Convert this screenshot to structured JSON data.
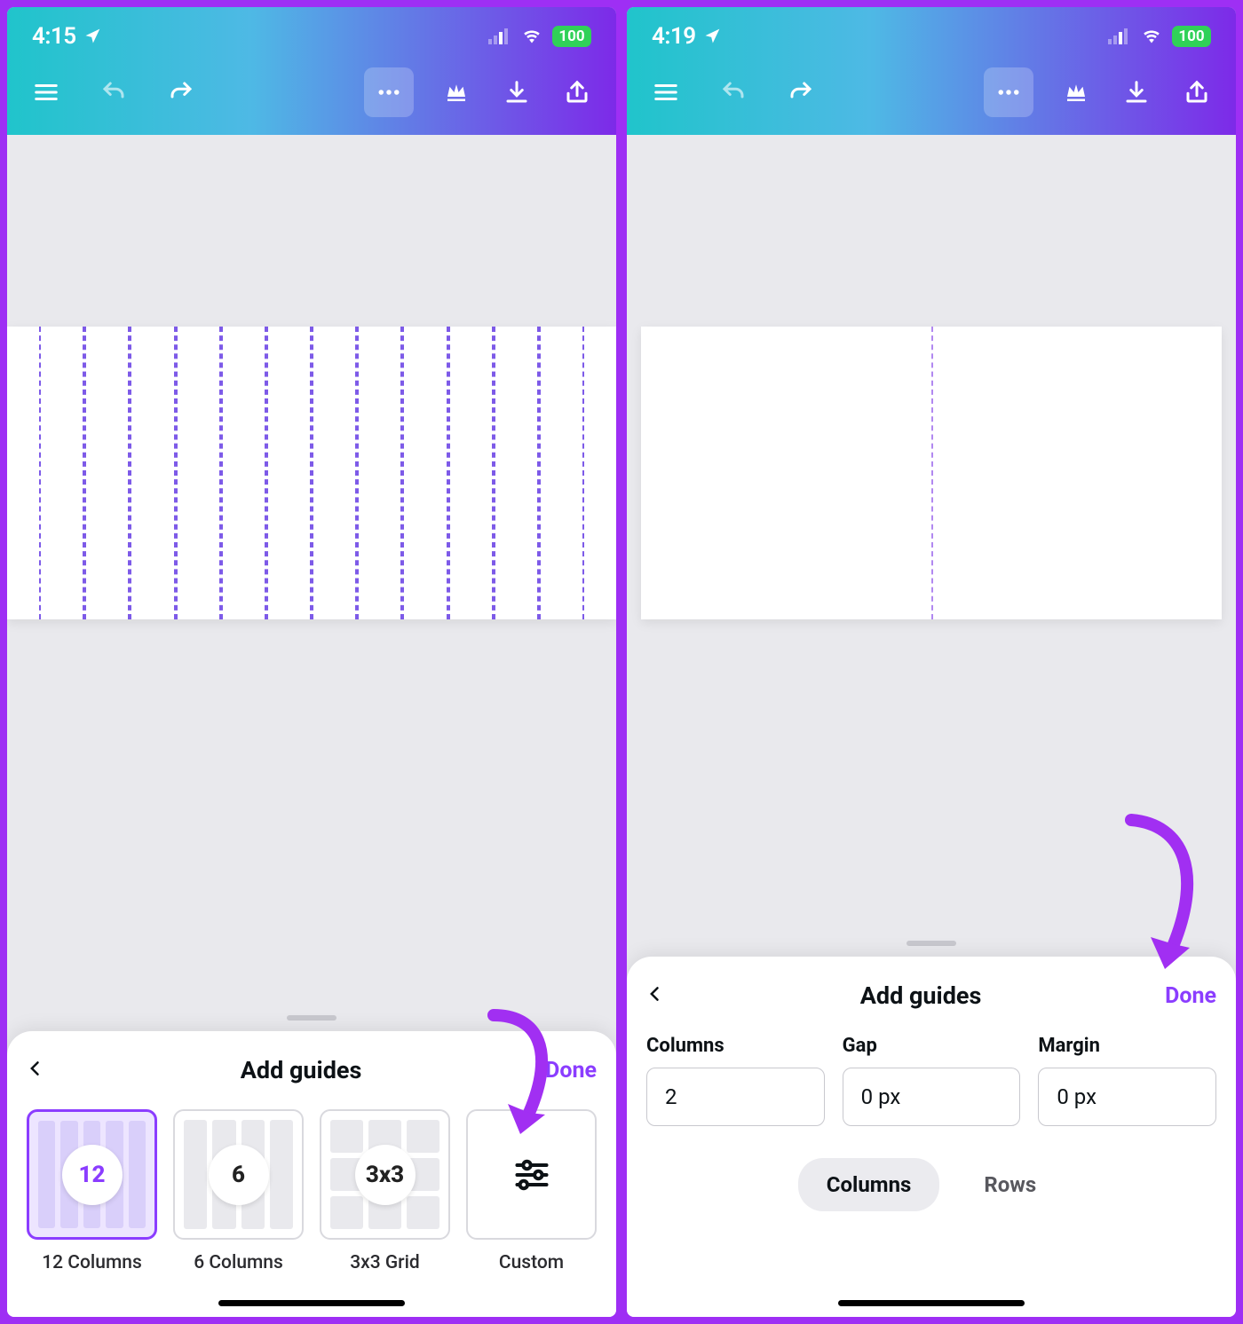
{
  "colors": {
    "accent": "#8b3dff",
    "annotation": "#a12ff2",
    "gradient_from": "#20c4cb",
    "gradient_to": "#7d2ae8"
  },
  "left": {
    "status": {
      "time": "4:15",
      "battery": "100"
    },
    "canvas": {
      "guide_columns": 12
    },
    "sheet": {
      "title": "Add guides",
      "done": "Done",
      "presets": [
        {
          "badge": "12",
          "label": "12 Columns",
          "type": "bars",
          "selected": true
        },
        {
          "badge": "6",
          "label": "6 Columns",
          "type": "bars",
          "selected": false
        },
        {
          "badge": "3x3",
          "label": "3x3 Grid",
          "type": "grid",
          "selected": false
        },
        {
          "badge": "",
          "label": "Custom",
          "type": "custom",
          "selected": false
        }
      ]
    }
  },
  "right": {
    "status": {
      "time": "4:19",
      "battery": "100"
    },
    "canvas": {
      "guide_columns": 2
    },
    "sheet": {
      "title": "Add guides",
      "done": "Done",
      "fields": {
        "columns": {
          "label": "Columns",
          "value": "2"
        },
        "gap": {
          "label": "Gap",
          "value": "0 px"
        },
        "margin": {
          "label": "Margin",
          "value": "0 px"
        }
      },
      "tabs": {
        "columns": "Columns",
        "rows": "Rows",
        "active": "columns"
      }
    }
  }
}
